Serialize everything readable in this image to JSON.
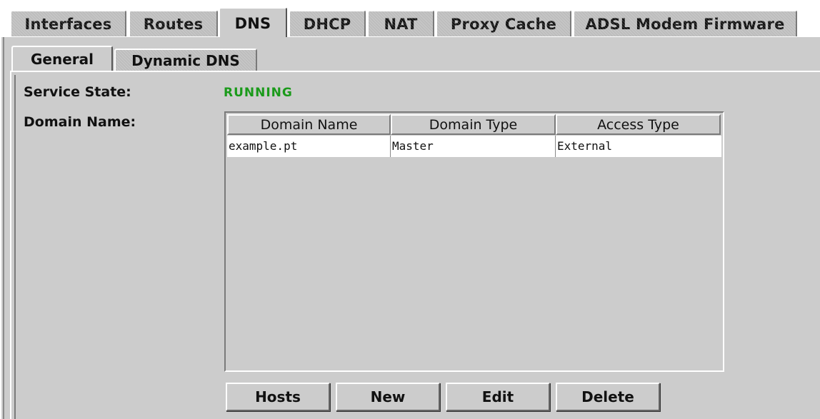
{
  "top_tabs": [
    {
      "label": "Interfaces",
      "selected": false
    },
    {
      "label": "Routes",
      "selected": false
    },
    {
      "label": "DNS",
      "selected": true
    },
    {
      "label": "DHCP",
      "selected": false
    },
    {
      "label": "NAT",
      "selected": false
    },
    {
      "label": "Proxy Cache",
      "selected": false
    },
    {
      "label": "ADSL Modem Firmware",
      "selected": false
    }
  ],
  "sub_tabs": [
    {
      "label": "General",
      "selected": true
    },
    {
      "label": "Dynamic DNS",
      "selected": false
    }
  ],
  "service_state": {
    "label": "Service State:",
    "value": "RUNNING",
    "color": "#1a9a1a"
  },
  "domain_name": {
    "label": "Domain Name:"
  },
  "table": {
    "columns": [
      "Domain Name",
      "Domain Type",
      "Access Type"
    ],
    "rows": [
      [
        "example.pt",
        "Master",
        "External"
      ]
    ]
  },
  "buttons": {
    "hosts": "Hosts",
    "new": "New",
    "edit": "Edit",
    "delete": "Delete"
  }
}
